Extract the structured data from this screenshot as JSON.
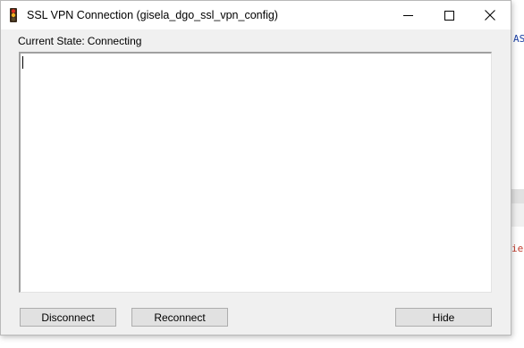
{
  "window": {
    "title": "SSL VPN Connection (gisela_dgo_ssl_vpn_config)"
  },
  "state": {
    "label": "Current State:",
    "value": "Connecting"
  },
  "log": {
    "text": ""
  },
  "buttons": {
    "disconnect": "Disconnect",
    "reconnect": "Reconnect",
    "hide": "Hide"
  },
  "background_app": {
    "text_top": "AS",
    "text_bottom": "ier"
  },
  "colors": {
    "dialog_bg": "#f0f0f0",
    "button_bg": "#e1e1e1",
    "background_text_blue": "#1a3fa3",
    "background_text_red": "#c0392b"
  },
  "icons": {
    "app": "traffic-light-icon",
    "minimize": "minimize-icon",
    "maximize": "maximize-icon",
    "close": "close-icon"
  }
}
